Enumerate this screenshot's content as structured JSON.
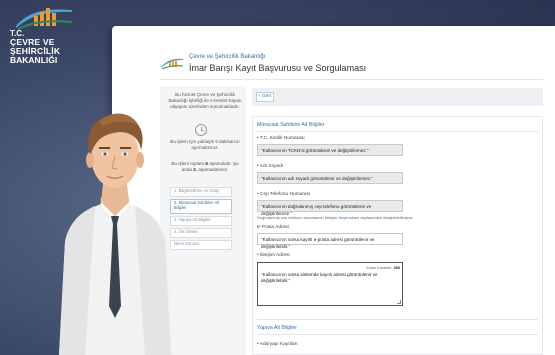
{
  "logo": {
    "line1": "T.C.",
    "line2": "ÇEVRE VE ŞEHİRCİLİK",
    "line3": "BAKANLIĞI",
    "bar_colors": [
      "#f29a2e",
      "#4aa5d6",
      "#2e8b57"
    ]
  },
  "header": {
    "ministry": "Çevre ve Şehircilik Bakanlığı",
    "title": "İmar Barışı Kayıt Başvurusu ve Sorgulaması"
  },
  "sidebar": {
    "info": "Bu hizmet Çevre ve Şehircilik Bakanlığı işbirliği ile e-Devlet Kapısı altyapısı üzerinden sunulmaktadır.",
    "time": "Bu işlem için yaklaşık 5 dakikanızı ayırmalısınız.",
    "steps_info_a": "Bu işlem toplam",
    "steps_total": "6",
    "steps_info_b": "aşamalıdır. Şu anda",
    "steps_current": "2.",
    "steps_info_c": "aşamadasınız.",
    "steps": [
      {
        "label": "1. Bilgilendirme ve Onay"
      },
      {
        "label": "2. Müracaat Sahibine Ait Bilgiler"
      },
      {
        "label": "3. Yapıya Ait Bilgiler"
      },
      {
        "label": "4. Ön İzleme"
      },
      {
        "label": "İşlem Sonucu"
      }
    ]
  },
  "content": {
    "back_label": "‹ Geri",
    "section1_title": "Müracaat Sahibine Ait Bilgiler",
    "fields": {
      "tc": {
        "label": "• T.C. Kimlik Numarası",
        "value": "\"Kullanıcının TCKN'si görüntülenir ve değiştirilemez.\""
      },
      "name": {
        "label": "• Adı Soyadı",
        "value": "\"Kullanıcının adı soyadı görüntülenir ve değiştirilemez.\""
      },
      "phone": {
        "label": "• Cep Telefonu Numarası",
        "value": "\"Kullanıcının doğrulanmış cep telefonu görüntülenir ve değiştirilemez.\""
      },
      "phone_help": "Doğrulanmış cep telefonu numaranızı",
      "phone_help_link": "İletişim Seçenekleri",
      "phone_help_tail": "sayfasından değiştirebilirsiniz.",
      "email": {
        "label": "E-Posta Adresi",
        "value": "\"Kullanıcının varsa kayıtlı e-posta adresi görüntülenir ve değiştirilebilir.\""
      },
      "address": {
        "label": "• İletişim Adresi",
        "value": "\"Kullanıcının varsa sistemde kayıtlı adresi görüntülenir ve değiştirilebilir.\"",
        "char_label": "Kalan Karakter:",
        "char_count": "300"
      }
    },
    "section2_title": "Yapıya Ait Bilgiler",
    "next_label": "• Ada/yapı Kayıtları"
  }
}
